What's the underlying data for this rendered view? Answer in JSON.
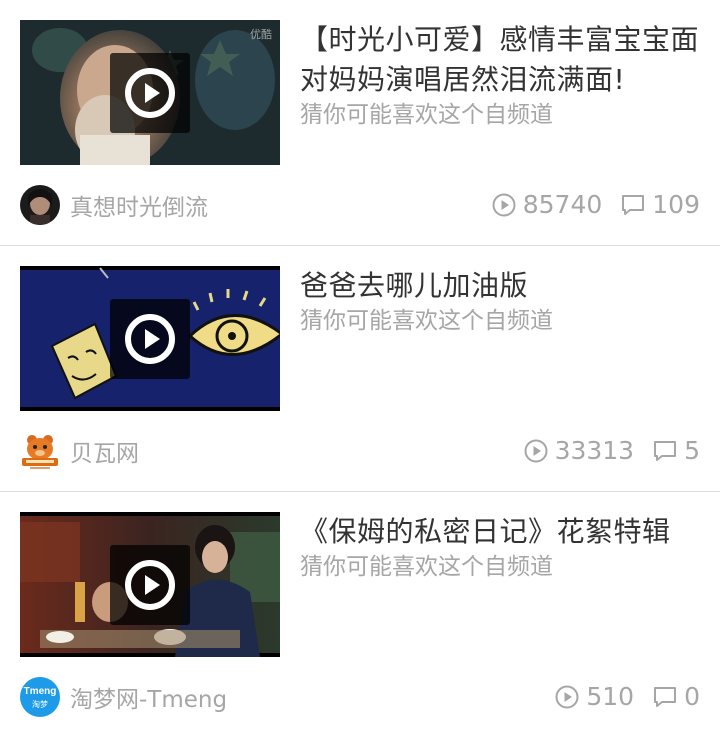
{
  "feed": {
    "items": [
      {
        "title": "【时光小可爱】感情丰富宝宝面对妈妈演唱居然泪流满面!",
        "subtitle": "猜你可能喜欢这个自频道",
        "channel": "真想时光倒流",
        "thumb_watermark": "优酷",
        "views": "85740",
        "comments": "109"
      },
      {
        "title": "爸爸去哪儿加油版",
        "subtitle": "猜你可能喜欢这个自频道",
        "channel": "贝瓦网",
        "views": "33313",
        "comments": "5"
      },
      {
        "title": "《保姆的私密日记》花絮特辑",
        "subtitle": "猜你可能喜欢这个自频道",
        "channel": "淘梦网-Tmeng",
        "avatar_text": "Tmeng",
        "avatar_subtext": "淘梦",
        "views": "510",
        "comments": "0"
      }
    ]
  },
  "icons": {
    "play": "play-icon",
    "views": "play-circle-icon",
    "comments": "comment-bubble-icon"
  },
  "colors": {
    "title": "#333333",
    "meta": "#a6a6a6",
    "divider": "#dcdcdc",
    "tmeng_blue": "#1e9be8"
  }
}
